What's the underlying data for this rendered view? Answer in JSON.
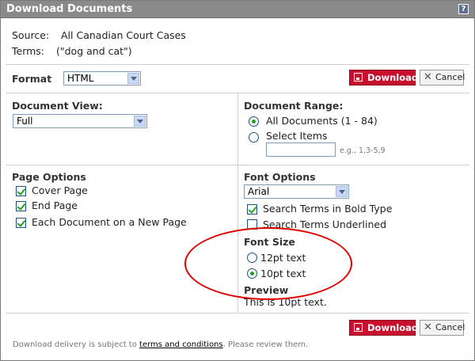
{
  "window": {
    "title": "Download Documents",
    "help_label": "?"
  },
  "source": {
    "label": "Source:",
    "value": "All Canadian Court Cases"
  },
  "terms": {
    "label": "Terms:",
    "value": "(\"dog and cat\")"
  },
  "format": {
    "label": "Format",
    "selected": "HTML"
  },
  "buttons": {
    "download_label": "Download",
    "cancel_label": "Cancel"
  },
  "document_view": {
    "label": "Document View:",
    "selected": "Full"
  },
  "document_range": {
    "label": "Document Range:",
    "all_label": "All Documents (1 - 84)",
    "select_label": "Select Items",
    "hint": "e.g., 1,3-5,9",
    "selected": "all"
  },
  "page_options": {
    "label": "Page Options",
    "items": [
      {
        "label": "Cover Page",
        "checked": true
      },
      {
        "label": "End Page",
        "checked": true
      },
      {
        "label": "Each Document on a New Page",
        "checked": true
      }
    ]
  },
  "font_options": {
    "label": "Font Options",
    "font_selected": "Arial",
    "bold_label": "Search Terms in Bold Type",
    "bold_checked": true,
    "underline_label": "Search Terms Underlined",
    "underline_checked": false
  },
  "font_size": {
    "label": "Font Size",
    "options": [
      {
        "label": "12pt text",
        "selected": false
      },
      {
        "label": "10pt text",
        "selected": true
      }
    ]
  },
  "preview": {
    "label": "Preview",
    "text": "This is 10pt text."
  },
  "footer": {
    "prefix": "Download delivery is subject to ",
    "link": "terms and conditions",
    "suffix": ". Please review them."
  },
  "colors": {
    "download_button": "#c8102e",
    "annotation_circle": "#e00000",
    "checkmark": "#21a121"
  }
}
